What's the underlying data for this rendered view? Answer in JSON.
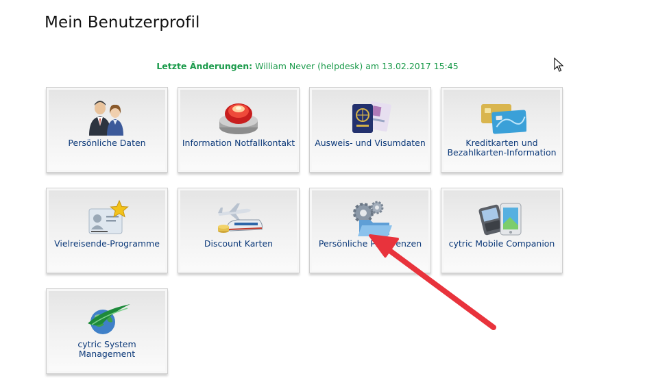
{
  "page": {
    "title": "Mein Benutzerprofil"
  },
  "last_changes": {
    "label": "Letzte Änderungen:",
    "value": "William Never (helpdesk) am 13.02.2017 15:45"
  },
  "tiles": [
    {
      "label": "Persönliche Daten",
      "icon": "people-icon"
    },
    {
      "label": "Information Notfallkontakt",
      "icon": "emergency-button-icon"
    },
    {
      "label": "Ausweis- und Visumdaten",
      "icon": "passport-icon"
    },
    {
      "label": "Kreditkarten und Bezahlkarten-Information",
      "icon": "credit-card-icon"
    },
    {
      "label": "Vielreisende-Programme",
      "icon": "frequent-flyer-card-icon"
    },
    {
      "label": "Discount Karten",
      "icon": "plane-train-icon"
    },
    {
      "label": "Persönliche Präferenzen",
      "icon": "gears-folder-icon"
    },
    {
      "label": "cytric Mobile Companion",
      "icon": "smartphones-icon"
    },
    {
      "label": "cytric System Management",
      "icon": "globe-icon"
    }
  ],
  "colors": {
    "title": "#111111",
    "last_changes": "#1a9a4a",
    "tile_label": "#0d3a7a",
    "annotation_arrow": "#e8333c"
  }
}
